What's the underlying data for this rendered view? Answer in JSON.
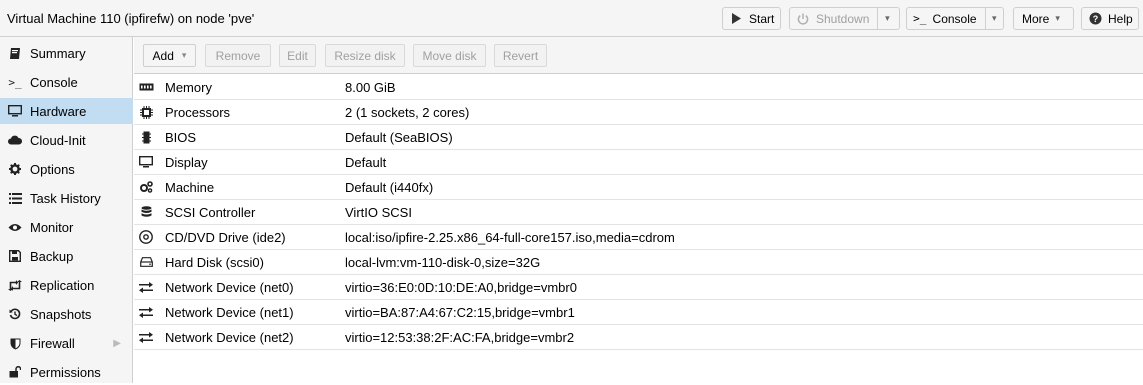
{
  "header": {
    "title": "Virtual Machine 110 (ipfirefw) on node 'pve'",
    "buttons": {
      "start": "Start",
      "shutdown": "Shutdown",
      "console": "Console",
      "more": "More",
      "help": "Help"
    }
  },
  "sidebar": {
    "items": [
      {
        "label": "Summary",
        "icon": "book-icon"
      },
      {
        "label": "Console",
        "icon": "terminal-icon"
      },
      {
        "label": "Hardware",
        "icon": "desktop-icon",
        "active": true
      },
      {
        "label": "Cloud-Init",
        "icon": "cloud-icon"
      },
      {
        "label": "Options",
        "icon": "gear-icon"
      },
      {
        "label": "Task History",
        "icon": "list-icon"
      },
      {
        "label": "Monitor",
        "icon": "eye-icon"
      },
      {
        "label": "Backup",
        "icon": "floppy-icon"
      },
      {
        "label": "Replication",
        "icon": "retweet-icon"
      },
      {
        "label": "Snapshots",
        "icon": "history-icon"
      },
      {
        "label": "Firewall",
        "icon": "shield-icon"
      },
      {
        "label": "Permissions",
        "icon": "unlock-icon"
      }
    ]
  },
  "toolbar": {
    "add": "Add",
    "remove": "Remove",
    "edit": "Edit",
    "resize": "Resize disk",
    "move": "Move disk",
    "revert": "Revert"
  },
  "hardware": [
    {
      "key": "Memory",
      "value": "8.00 GiB",
      "icon": "memory-icon"
    },
    {
      "key": "Processors",
      "value": "2 (1 sockets, 2 cores)",
      "icon": "cpu-icon"
    },
    {
      "key": "BIOS",
      "value": "Default (SeaBIOS)",
      "icon": "microchip-icon"
    },
    {
      "key": "Display",
      "value": "Default",
      "icon": "desktop-icon"
    },
    {
      "key": "Machine",
      "value": "Default (i440fx)",
      "icon": "cogs-icon"
    },
    {
      "key": "SCSI Controller",
      "value": "VirtIO SCSI",
      "icon": "database-icon"
    },
    {
      "key": "CD/DVD Drive (ide2)",
      "value": "local:iso/ipfire-2.25.x86_64-full-core157.iso,media=cdrom",
      "icon": "disc-icon"
    },
    {
      "key": "Hard Disk (scsi0)",
      "value": "local-lvm:vm-110-disk-0,size=32G",
      "icon": "hdd-icon"
    },
    {
      "key": "Network Device (net0)",
      "value": "virtio=36:E0:0D:10:DE:A0,bridge=vmbr0",
      "icon": "exchange-icon"
    },
    {
      "key": "Network Device (net1)",
      "value": "virtio=BA:87:A4:67:C2:15,bridge=vmbr1",
      "icon": "exchange-icon"
    },
    {
      "key": "Network Device (net2)",
      "value": "virtio=12:53:38:2F:AC:FA,bridge=vmbr2",
      "icon": "exchange-icon"
    }
  ],
  "colors": {
    "active_nav": "#c2ddf2",
    "panel_bg": "#f5f5f5",
    "border": "#cfcfcf",
    "disabled_text": "#a0a0a0"
  }
}
